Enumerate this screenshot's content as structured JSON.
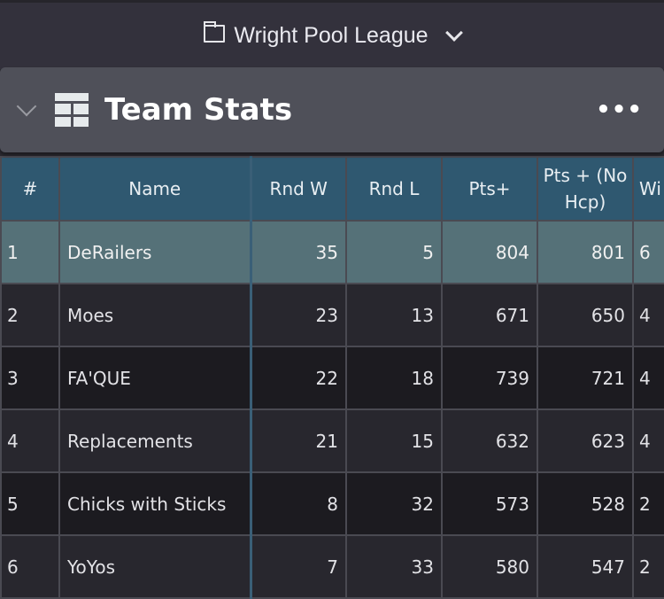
{
  "header": {
    "title": "Wright Pool League",
    "folder_icon": "folder-icon",
    "dropdown_icon": "chevron-down-icon"
  },
  "panel": {
    "title": "Team Stats",
    "icon": "table-icon",
    "menu": "•••"
  },
  "colors": {
    "header_bg": "#2f5870",
    "highlight_row": "#557178"
  },
  "table": {
    "columns": [
      "#",
      "Name",
      "Rnd W",
      "Rnd L",
      "Pts+",
      "Pts + (No Hcp)",
      "Wi"
    ],
    "rows": [
      [
        "1",
        "DeRailers",
        "35",
        "5",
        "804",
        "801",
        "6"
      ],
      [
        "2",
        "Moes",
        "23",
        "13",
        "671",
        "650",
        "4"
      ],
      [
        "3",
        "FA'QUE",
        "22",
        "18",
        "739",
        "721",
        "4"
      ],
      [
        "4",
        "Replacements",
        "21",
        "15",
        "632",
        "623",
        "4"
      ],
      [
        "5",
        "Chicks with Sticks",
        "8",
        "32",
        "573",
        "528",
        "2"
      ],
      [
        "6",
        "YoYos",
        "7",
        "33",
        "580",
        "547",
        "2"
      ]
    ]
  }
}
